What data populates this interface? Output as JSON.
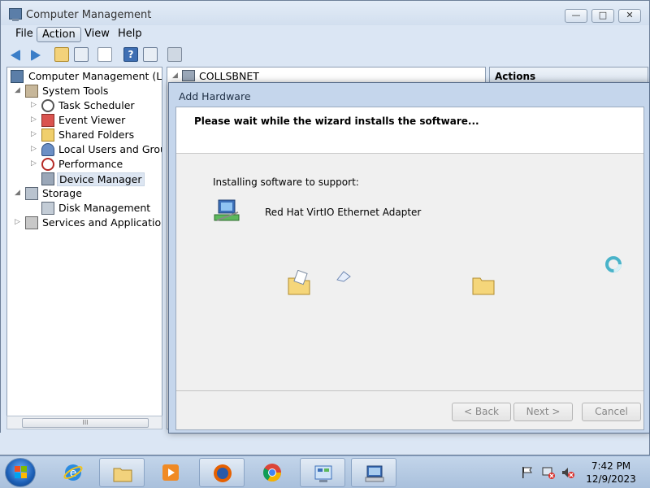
{
  "window": {
    "title": "Computer Management",
    "buttons": {
      "minimize": "—",
      "maximize": "□",
      "close": "✕"
    }
  },
  "menu": [
    "File",
    "Action",
    "View",
    "Help"
  ],
  "menu_active": "Action",
  "tree": {
    "root": "Computer Management (Local",
    "items": [
      {
        "label": "System Tools",
        "icon": "tools-icon"
      },
      {
        "label": "Task Scheduler",
        "icon": "clock-icon"
      },
      {
        "label": "Event Viewer",
        "icon": "event-viewer-icon"
      },
      {
        "label": "Shared Folders",
        "icon": "shared-folder-icon"
      },
      {
        "label": "Local Users and Groups",
        "icon": "users-icon"
      },
      {
        "label": "Performance",
        "icon": "performance-icon"
      },
      {
        "label": "Device Manager",
        "icon": "device-manager-icon"
      },
      {
        "label": "Storage",
        "icon": "storage-icon"
      },
      {
        "label": "Disk Management",
        "icon": "disk-icon"
      },
      {
        "label": "Services and Applications",
        "icon": "services-icon"
      }
    ],
    "scroll_grip": "III"
  },
  "middle": {
    "root_node": "COLLSBNET"
  },
  "actions": {
    "header": "Actions"
  },
  "dialog": {
    "title": "Add Hardware",
    "heading": "Please wait while the wizard installs the software...",
    "support_label": "Installing software to support:",
    "device_name": "Red Hat VirtIO Ethernet Adapter",
    "buttons": {
      "back": "< Back",
      "next": "Next >",
      "cancel": "Cancel"
    }
  },
  "taskbar": {
    "apps": [
      "internet-explorer-icon",
      "file-explorer-icon",
      "media-player-icon",
      "firefox-icon",
      "chrome-icon",
      "control-panel-icon",
      "computer-management-icon"
    ],
    "time": "7:42 PM",
    "date": "12/9/2023"
  },
  "colors": {
    "accent": "#dbe6f4",
    "dialog_frame": "#c5d6ec",
    "taskbar": "#b5cae2"
  }
}
